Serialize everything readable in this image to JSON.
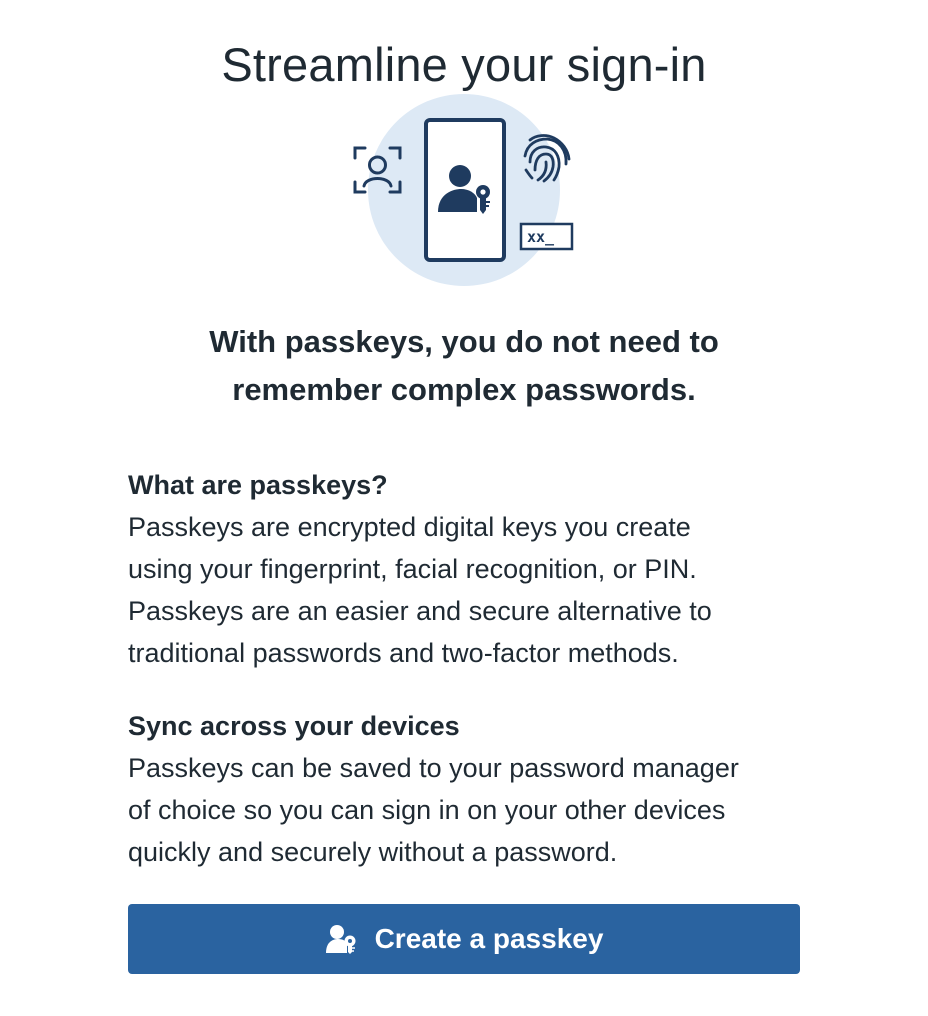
{
  "header": {
    "title": "Streamline your sign-in"
  },
  "hero": {
    "illustration_icons": [
      "face-scan-icon",
      "phone-passkey-icon",
      "fingerprint-icon",
      "password-field-icon"
    ],
    "password_placeholder": "xx_",
    "headline_line1": "With passkeys, you do not need to",
    "headline_line2": "remember complex passwords."
  },
  "sections": [
    {
      "heading": "What are passkeys?",
      "lines": [
        "Passkeys are encrypted digital keys you create",
        "using your fingerprint, facial recognition, or PIN.",
        "Passkeys are an easier and secure alternative to",
        "traditional passwords and two-factor methods."
      ]
    },
    {
      "heading": "Sync across your devices",
      "lines": [
        "Passkeys can be saved to your password manager",
        "of choice so you can sign in on your other devices",
        "quickly and securely without a password."
      ]
    }
  ],
  "actions": {
    "create_label": "Create a passkey",
    "create_icon": "user-key-icon"
  },
  "colors": {
    "text": "#1f2a33",
    "accent": "#2a63a0",
    "illustration_fill": "#dde9f5",
    "illustration_stroke": "#1f3b5f"
  }
}
